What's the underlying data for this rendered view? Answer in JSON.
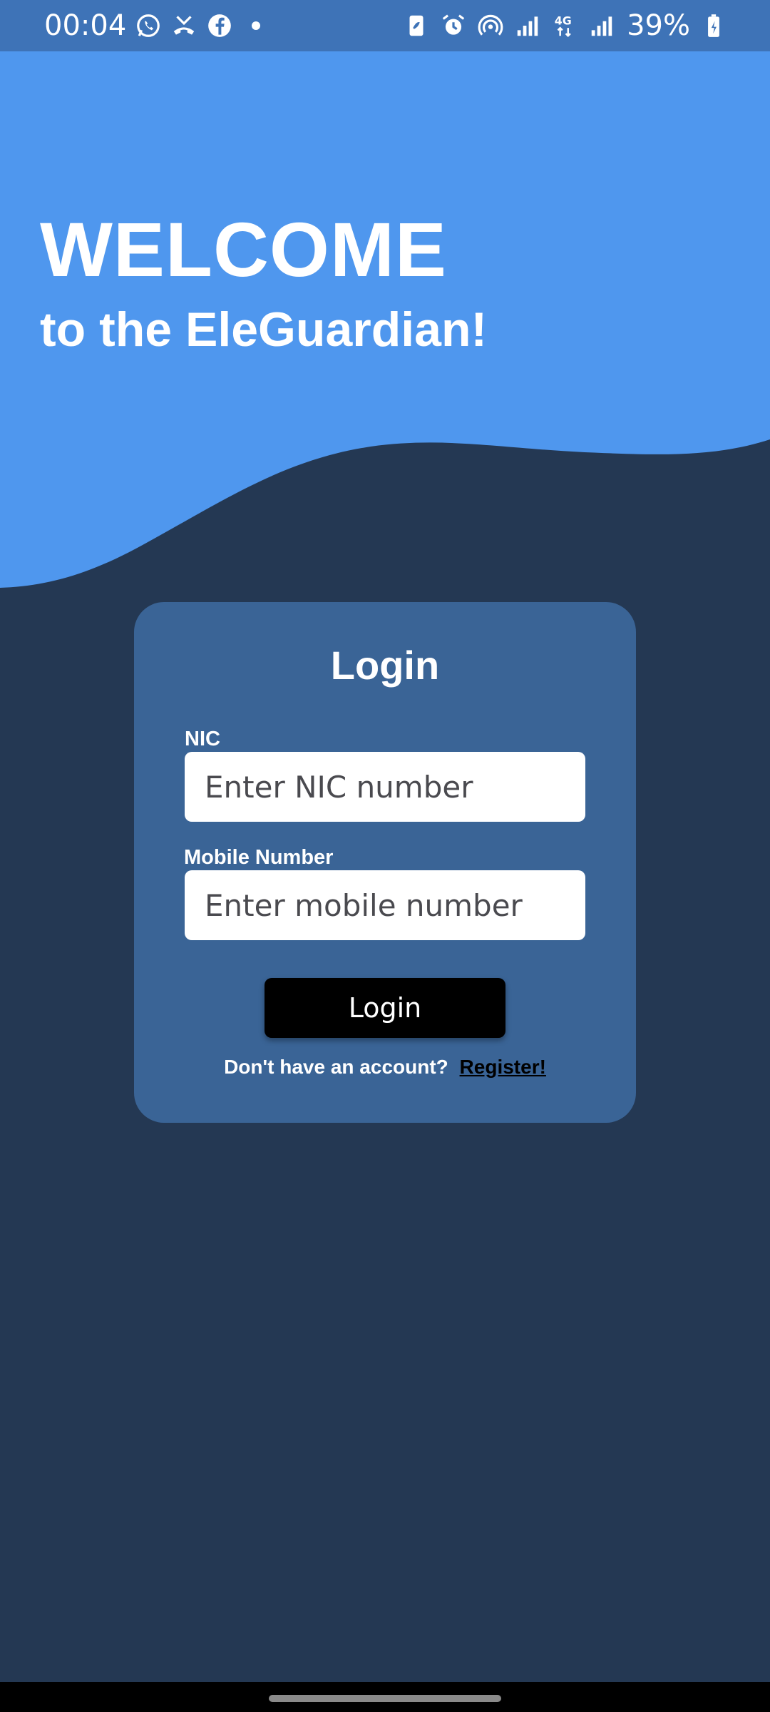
{
  "status_bar": {
    "time": "00:04",
    "battery": "39%",
    "left_icons": [
      "whatsapp-icon",
      "missed-call-icon",
      "facebook-icon",
      "notification-dot"
    ],
    "right_icons": [
      "battery-saver-icon",
      "alarm-icon",
      "hotspot-icon",
      "signal-icon",
      "4g-icon",
      "signal-icon",
      "battery-icon"
    ],
    "color": "#3e73b7"
  },
  "header": {
    "title": "WELCOME",
    "subtitle": "to the EleGuardian!",
    "color": "#4f97ee"
  },
  "login_card": {
    "title": "Login",
    "nic": {
      "label": "NIC",
      "placeholder": "Enter NIC number",
      "value": ""
    },
    "mobile": {
      "label": "Mobile Number",
      "placeholder": "Enter mobile number",
      "value": ""
    },
    "login_button": "Login",
    "register_prompt": "Don't have an account? ",
    "register_link": "Register!",
    "color": "#3a6496"
  },
  "theme": {
    "background": "#243853",
    "button": "#000000"
  }
}
